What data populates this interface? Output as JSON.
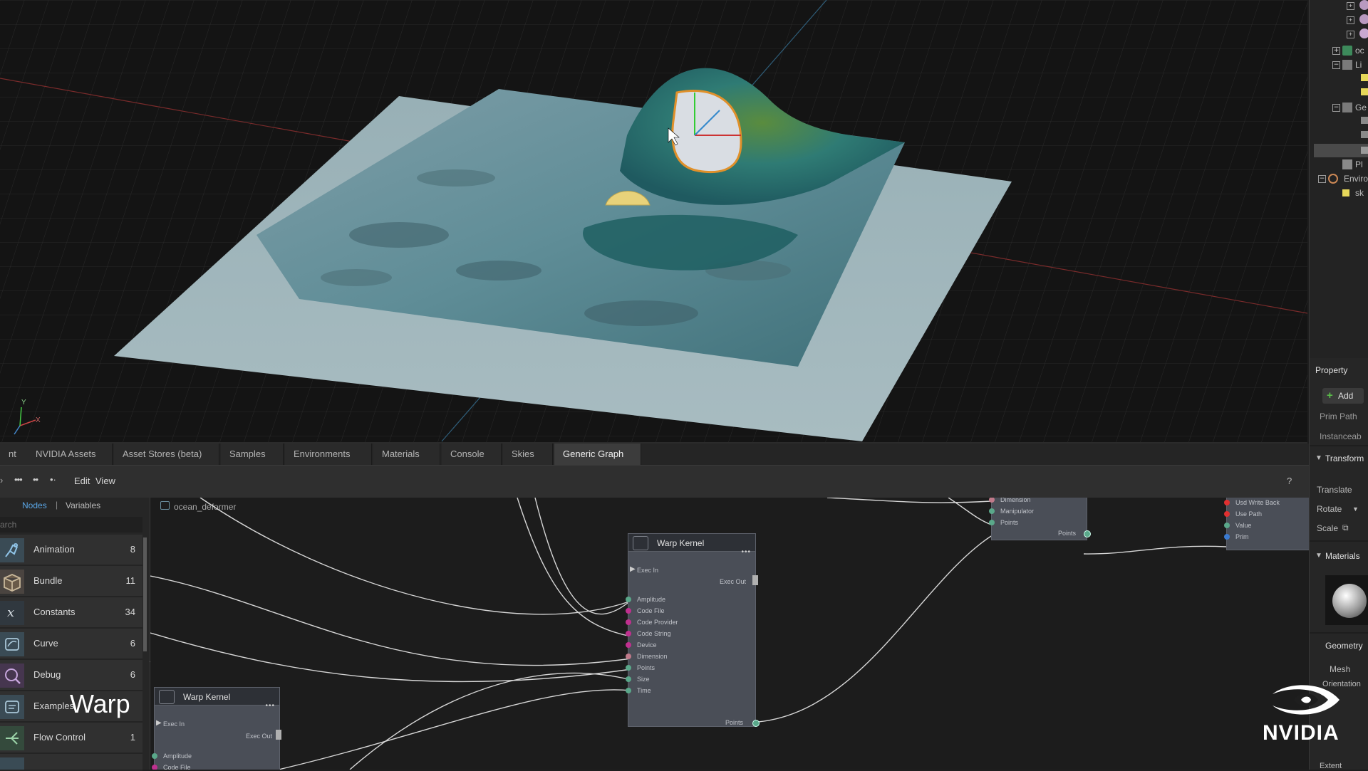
{
  "viewport": {
    "axis_x": "X",
    "axis_y": "Y"
  },
  "stage_tree": [
    {
      "label": "oc",
      "toggle": ""
    },
    {
      "label": "Li",
      "toggle": "−"
    },
    {
      "label": "Ge",
      "toggle": "−"
    },
    {
      "label": "Pl",
      "toggle": ""
    },
    {
      "label": "Enviro",
      "toggle": "−"
    },
    {
      "label": "sk",
      "toggle": ""
    }
  ],
  "property": {
    "title": "Property",
    "add_label": "Add",
    "prim_path": "Prim Path",
    "instanceable": "Instanceab",
    "transform": "Transform",
    "translate": "Translate",
    "rotate": "Rotate",
    "scale": "Scale",
    "materials": "Materials",
    "geometry": "Geometry",
    "mesh": "Mesh",
    "orientation": "Orientation",
    "extent": "Extent"
  },
  "tabs": [
    {
      "label": "nt"
    },
    {
      "label": "NVIDIA Assets"
    },
    {
      "label": "Asset Stores (beta)"
    },
    {
      "label": "Samples"
    },
    {
      "label": "Environments"
    },
    {
      "label": "Materials"
    },
    {
      "label": "Console"
    },
    {
      "label": "Skies"
    },
    {
      "label": "Generic Graph",
      "active": true
    }
  ],
  "graph_toolbar": {
    "edit": "Edit",
    "view": "View",
    "help": "?"
  },
  "library": {
    "tab_nodes": "Nodes",
    "tab_variables": "Variables",
    "separator": "|",
    "search_placeholder": "arch",
    "items": [
      {
        "name": "Animation",
        "count": "8",
        "icon": "running-figure-icon"
      },
      {
        "name": "Bundle",
        "count": "11",
        "icon": "box-icon"
      },
      {
        "name": "Constants",
        "count": "34",
        "icon": "variable-x-icon"
      },
      {
        "name": "Curve",
        "count": "6",
        "icon": "curve-node-icon"
      },
      {
        "name": "Debug",
        "count": "6",
        "icon": "debug-icon"
      },
      {
        "name": "Examples",
        "count": "",
        "icon": "examples-icon"
      },
      {
        "name": "Flow Control",
        "count": "1",
        "icon": "flow-control-icon"
      }
    ]
  },
  "graph": {
    "breadcrumb": "ocean_deformer",
    "warp_kernel_main": {
      "title": "Warp Kernel",
      "inputs": [
        "Exec In",
        "Amplitude",
        "Code File",
        "Code Provider",
        "Code String",
        "Device",
        "Dimension",
        "Points",
        "Size",
        "Time"
      ],
      "exec_out": "Exec Out",
      "points_out": "Points"
    },
    "warp_kernel_secondary": {
      "title": "Warp Kernel",
      "inputs": [
        "Exec In",
        "Amplitude",
        "Code File"
      ],
      "exec_out": "Exec Out"
    },
    "top_node": {
      "inputs": [
        "Dimension",
        "Manipulator",
        "Points"
      ],
      "output": "Points"
    },
    "write_node": {
      "inputs": [
        "Usd Write Back",
        "Use Path",
        "Value",
        "Prim"
      ]
    }
  },
  "overlay": {
    "caption": "Warp",
    "brand": "NVIDIA"
  }
}
